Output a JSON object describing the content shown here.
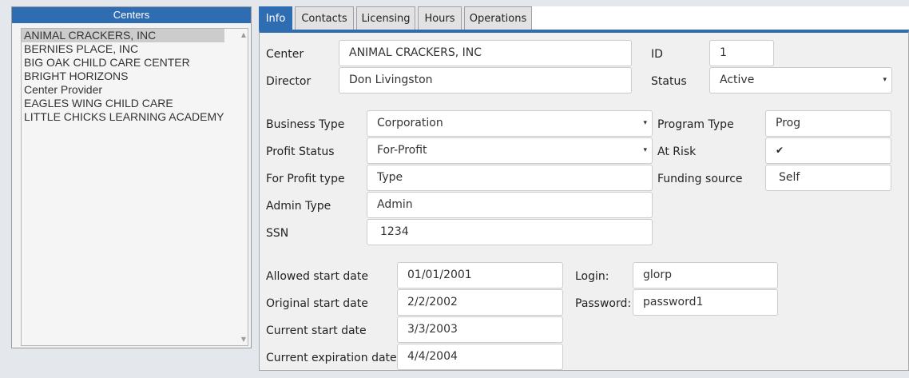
{
  "centers": {
    "title": "Centers",
    "items": [
      {
        "label": "ANIMAL CRACKERS, INC",
        "selected": true
      },
      {
        "label": "BERNIES PLACE, INC"
      },
      {
        "label": "BIG OAK CHILD CARE CENTER"
      },
      {
        "label": "BRIGHT HORIZONS"
      },
      {
        "label": "Center Provider"
      },
      {
        "label": "EAGLES WING CHILD CARE"
      },
      {
        "label": "LITTLE CHICKS LEARNING ACADEMY"
      }
    ]
  },
  "tabs": [
    {
      "label": "Info",
      "active": true
    },
    {
      "label": "Contacts"
    },
    {
      "label": "Licensing"
    },
    {
      "label": "Hours"
    },
    {
      "label": "Operations"
    }
  ],
  "form": {
    "center": {
      "label": "Center",
      "value": "ANIMAL CRACKERS, INC"
    },
    "id": {
      "label": "ID",
      "value": "1"
    },
    "director": {
      "label": "Director",
      "value": "Don Livingston"
    },
    "status": {
      "label": "Status",
      "value": "Active"
    },
    "business_type": {
      "label": "Business Type",
      "value": "Corporation"
    },
    "program_type": {
      "label": "Program Type",
      "value": "Prog"
    },
    "profit_status": {
      "label": "Profit Status",
      "value": "For-Profit"
    },
    "at_risk": {
      "label": "At Risk",
      "checked": true,
      "mark": "✔"
    },
    "for_profit_type": {
      "label": "For Profit type",
      "value": "Type"
    },
    "funding_source": {
      "label": "Funding source",
      "value": "Self"
    },
    "admin_type": {
      "label": "Admin Type",
      "value": "Admin"
    },
    "ssn": {
      "label": "SSN",
      "value": "1234"
    },
    "allowed_start": {
      "label": "Allowed start date",
      "value": "01/01/2001"
    },
    "login": {
      "label": "Login:",
      "value": "glorp"
    },
    "original_start": {
      "label": "Original start date",
      "value": "2/2/2002"
    },
    "password": {
      "label": "Password:",
      "value": "password1"
    },
    "current_start": {
      "label": "Current start date",
      "value": "3/3/2003"
    },
    "current_expiration": {
      "label": "Current expiration date",
      "value": "4/4/2004"
    }
  },
  "icons": {
    "dropdown": "▾",
    "scroll_up": "▲",
    "scroll_down": "▼"
  },
  "colors": {
    "accent": "#2f6db3",
    "selected_row": "#cccccc"
  }
}
